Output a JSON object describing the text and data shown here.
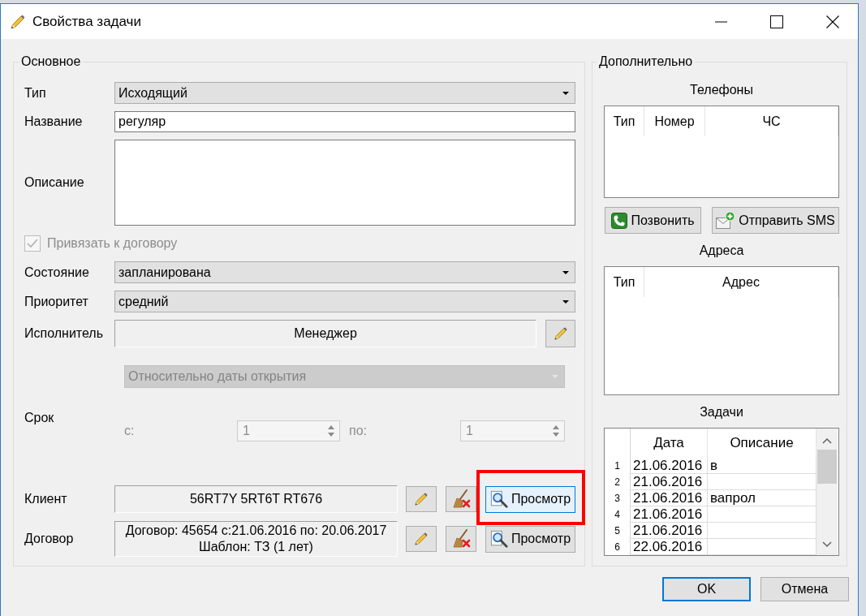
{
  "window": {
    "title": "Свойства задачи"
  },
  "main": {
    "title": "Основное",
    "fields": [
      {
        "kind": "combo",
        "label": "Тип",
        "value": "Исходящий"
      },
      {
        "kind": "text",
        "label": "Название",
        "value": "регуляр"
      },
      {
        "kind": "textarea",
        "label": "Описание"
      },
      {
        "kind": "checkbox",
        "label": "Привязать к договору",
        "checked": true,
        "disabled": true
      },
      {
        "kind": "combo",
        "label": "Состояние",
        "value": "запланирована"
      },
      {
        "kind": "combo",
        "label": "Приоритет",
        "value": "средний"
      },
      {
        "kind": "picker",
        "label": "Исполнитель",
        "value": "Менеджер"
      }
    ],
    "deadline": {
      "label": "Срок",
      "mode": "Относительно даты открытия",
      "disabled": true,
      "from_label": "с:",
      "from_value": "1",
      "to_label": "по:",
      "to_value": "1"
    },
    "links": [
      {
        "label": "Клиент",
        "lines": [
          "56RT7Y 5RT6T RT676"
        ],
        "view_button": {
          "label": "Просмотр",
          "hovered": true,
          "highlighted": true
        }
      },
      {
        "label": "Договор",
        "lines": [
          "Договор: 45654 с:21.06.2016 по: 20.06.2017",
          "Шаблон: ТЗ (1 лет)"
        ],
        "view_button": {
          "label": "Просмотр",
          "hovered": false,
          "highlighted": false
        }
      }
    ]
  },
  "extra": {
    "title": "Дополнительно",
    "phones": {
      "title": "Телефоны",
      "columns": [
        "Тип",
        "Номер",
        "ЧС"
      ]
    },
    "phone_buttons": [
      {
        "kind": "call",
        "label": "Позвонить"
      },
      {
        "kind": "sms",
        "label": "Отправить SMS"
      }
    ],
    "addresses": {
      "title": "Адреса",
      "columns": [
        "Тип",
        "Адрес"
      ]
    },
    "tasks": {
      "title": "Задачи",
      "columns": [
        "Дата",
        "Описание"
      ],
      "rows": [
        {
          "number": "1",
          "date": "21.06.2016",
          "description": "в"
        },
        {
          "number": "2",
          "date": "21.06.2016"
        },
        {
          "number": "3",
          "date": "21.06.2016",
          "description": "вапрол"
        },
        {
          "number": "4",
          "date": "21.06.2016"
        },
        {
          "number": "5",
          "date": "21.06.2016"
        },
        {
          "number": "6",
          "date": "22.06.2016"
        }
      ]
    }
  },
  "buttons": [
    {
      "label": "OK",
      "default": true
    },
    {
      "label": "Отмена",
      "default": false
    }
  ]
}
